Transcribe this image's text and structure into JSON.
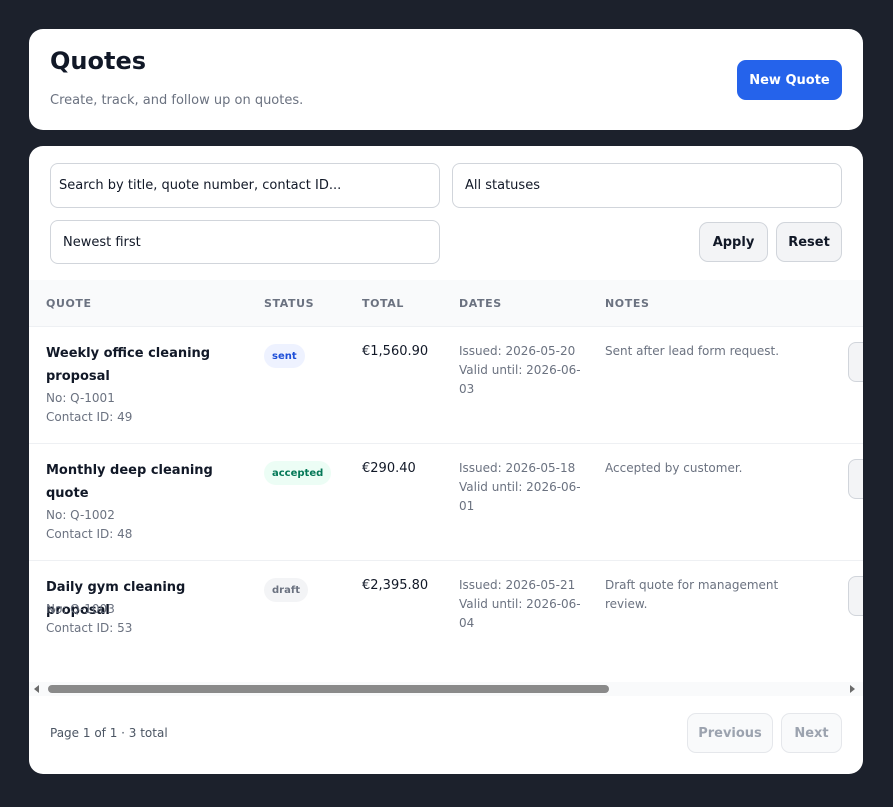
{
  "header": {
    "title": "Quotes",
    "subtitle": "Create, track, and follow up on quotes.",
    "new_quote_label": "New Quote"
  },
  "filters": {
    "search_placeholder": "Search by title, quote number, contact ID...",
    "search_value": "",
    "status_selected": "All statuses",
    "sort_selected": "Newest first",
    "apply_label": "Apply",
    "reset_label": "Reset"
  },
  "table": {
    "columns": [
      "QUOTE",
      "STATUS",
      "TOTAL",
      "DATES",
      "NOTES"
    ],
    "rows": [
      {
        "title": "Weekly office cleaning proposal",
        "number": "No: Q-1001",
        "contact": "Contact ID: 49",
        "status": "sent",
        "total": "€1,560.90",
        "issued": "Issued: 2026-05-20",
        "valid_until": "Valid until: 2026-06-03",
        "notes": "Sent after lead form request."
      },
      {
        "title": "Monthly deep cleaning quote",
        "number": "No: Q-1002",
        "contact": "Contact ID: 48",
        "status": "accepted",
        "total": "€290.40",
        "issued": "Issued: 2026-05-18",
        "valid_until": "Valid until: 2026-06-01",
        "notes": "Accepted by customer."
      },
      {
        "title": "Daily gym cleaning proposal",
        "number": "No: Q-1003",
        "contact": "Contact ID: 53",
        "status": "draft",
        "total": "€2,395.80",
        "issued": "Issued: 2026-05-21",
        "valid_until": "Valid until: 2026-06-04",
        "notes": "Draft quote for management review."
      }
    ]
  },
  "pagination": {
    "info": "Page 1 of 1 · 3 total",
    "previous_label": "Previous",
    "next_label": "Next"
  },
  "colors": {
    "background": "#1c212c",
    "accent": "#2563eb",
    "status_sent": "#1d4ed8",
    "status_accepted": "#047857",
    "status_draft": "#6b7280"
  }
}
